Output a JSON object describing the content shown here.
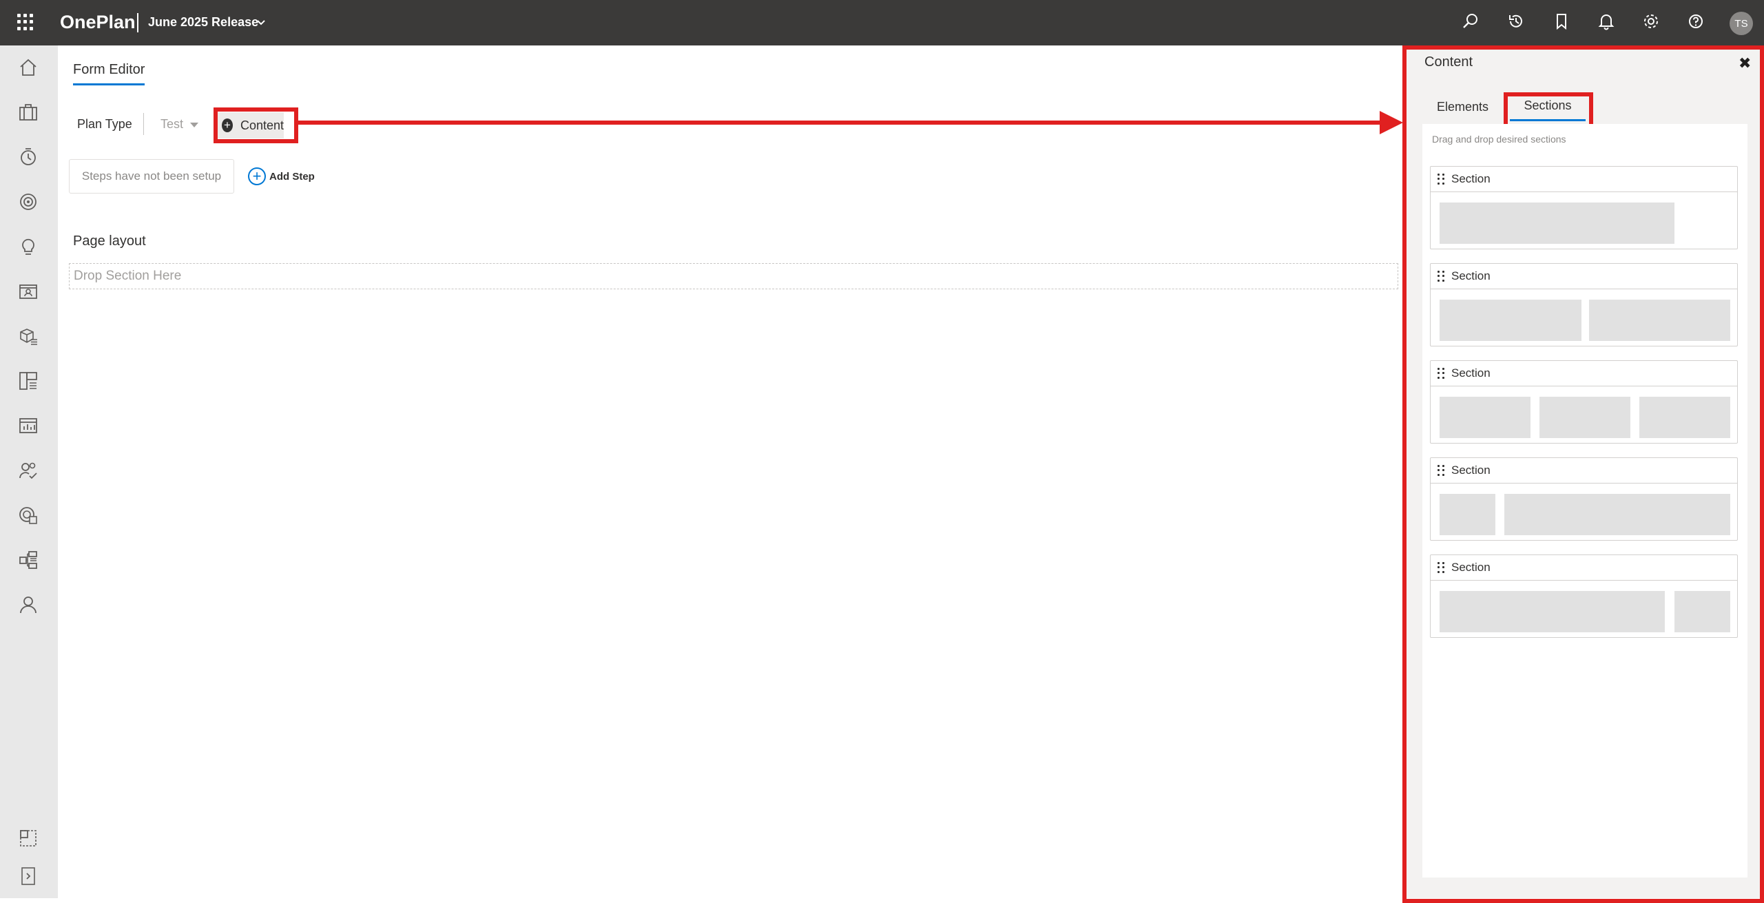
{
  "topbar": {
    "app_name": "OnePlan",
    "release_label": "June 2025 Release",
    "user_initials": "TS"
  },
  "form_editor": {
    "tab_label": "Form Editor",
    "plan_type_label": "Plan Type",
    "plan_type_value": "Test",
    "content_button_label": "Content",
    "steps_placeholder": "Steps have not been setup",
    "add_step_label": "Add Step",
    "page_layout_label": "Page layout",
    "drop_zone_text": "Drop Section Here"
  },
  "content_panel": {
    "title": "Content",
    "tabs": [
      {
        "label": "Elements",
        "active": false
      },
      {
        "label": "Sections",
        "active": true
      }
    ],
    "hint": "Drag and drop desired sections",
    "sections": [
      {
        "label": "Section",
        "layout": "1 column"
      },
      {
        "label": "Section",
        "layout": "2 equal columns"
      },
      {
        "label": "Section",
        "layout": "3 equal columns"
      },
      {
        "label": "Section",
        "layout": "narrow-wide"
      },
      {
        "label": "Section",
        "layout": "wide-narrow"
      }
    ]
  },
  "colors": {
    "topbar": "#3b3a39",
    "accent": "#0078d4",
    "highlight": "#e02020",
    "nav_bg": "#e8e8e8"
  },
  "icons": {
    "topbar": [
      "search-icon",
      "history-icon",
      "bookmark-icon",
      "bell-icon",
      "gear-icon",
      "help-icon"
    ],
    "leftnav": [
      "home-icon",
      "briefcase-icon",
      "timer-icon",
      "target-icon",
      "lightbulb-icon",
      "contact-card-icon",
      "package-list-icon",
      "layout-grid-icon",
      "chart-icon",
      "people-check-icon",
      "report-globe-icon",
      "hierarchy-icon",
      "person-icon",
      "select-box-icon",
      "expand-icon"
    ]
  }
}
